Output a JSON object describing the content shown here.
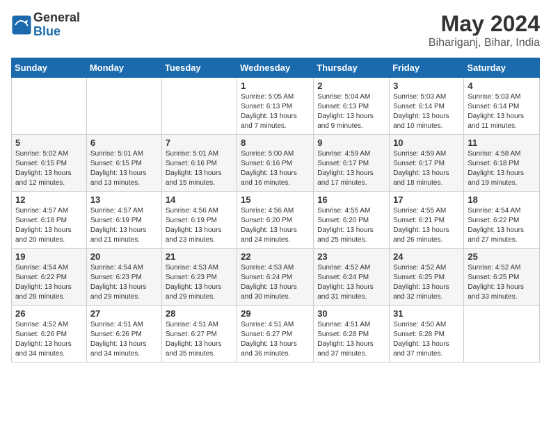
{
  "logo": {
    "general": "General",
    "blue": "Blue"
  },
  "title": {
    "month_year": "May 2024",
    "location": "Bihariganj, Bihar, India"
  },
  "weekdays": [
    "Sunday",
    "Monday",
    "Tuesday",
    "Wednesday",
    "Thursday",
    "Friday",
    "Saturday"
  ],
  "weeks": [
    [
      {
        "day": "",
        "sunrise": "",
        "sunset": "",
        "daylight": ""
      },
      {
        "day": "",
        "sunrise": "",
        "sunset": "",
        "daylight": ""
      },
      {
        "day": "",
        "sunrise": "",
        "sunset": "",
        "daylight": ""
      },
      {
        "day": "1",
        "sunrise": "Sunrise: 5:05 AM",
        "sunset": "Sunset: 6:13 PM",
        "daylight": "Daylight: 13 hours and 7 minutes."
      },
      {
        "day": "2",
        "sunrise": "Sunrise: 5:04 AM",
        "sunset": "Sunset: 6:13 PM",
        "daylight": "Daylight: 13 hours and 9 minutes."
      },
      {
        "day": "3",
        "sunrise": "Sunrise: 5:03 AM",
        "sunset": "Sunset: 6:14 PM",
        "daylight": "Daylight: 13 hours and 10 minutes."
      },
      {
        "day": "4",
        "sunrise": "Sunrise: 5:03 AM",
        "sunset": "Sunset: 6:14 PM",
        "daylight": "Daylight: 13 hours and 11 minutes."
      }
    ],
    [
      {
        "day": "5",
        "sunrise": "Sunrise: 5:02 AM",
        "sunset": "Sunset: 6:15 PM",
        "daylight": "Daylight: 13 hours and 12 minutes."
      },
      {
        "day": "6",
        "sunrise": "Sunrise: 5:01 AM",
        "sunset": "Sunset: 6:15 PM",
        "daylight": "Daylight: 13 hours and 13 minutes."
      },
      {
        "day": "7",
        "sunrise": "Sunrise: 5:01 AM",
        "sunset": "Sunset: 6:16 PM",
        "daylight": "Daylight: 13 hours and 15 minutes."
      },
      {
        "day": "8",
        "sunrise": "Sunrise: 5:00 AM",
        "sunset": "Sunset: 6:16 PM",
        "daylight": "Daylight: 13 hours and 16 minutes."
      },
      {
        "day": "9",
        "sunrise": "Sunrise: 4:59 AM",
        "sunset": "Sunset: 6:17 PM",
        "daylight": "Daylight: 13 hours and 17 minutes."
      },
      {
        "day": "10",
        "sunrise": "Sunrise: 4:59 AM",
        "sunset": "Sunset: 6:17 PM",
        "daylight": "Daylight: 13 hours and 18 minutes."
      },
      {
        "day": "11",
        "sunrise": "Sunrise: 4:58 AM",
        "sunset": "Sunset: 6:18 PM",
        "daylight": "Daylight: 13 hours and 19 minutes."
      }
    ],
    [
      {
        "day": "12",
        "sunrise": "Sunrise: 4:57 AM",
        "sunset": "Sunset: 6:18 PM",
        "daylight": "Daylight: 13 hours and 20 minutes."
      },
      {
        "day": "13",
        "sunrise": "Sunrise: 4:57 AM",
        "sunset": "Sunset: 6:19 PM",
        "daylight": "Daylight: 13 hours and 21 minutes."
      },
      {
        "day": "14",
        "sunrise": "Sunrise: 4:56 AM",
        "sunset": "Sunset: 6:19 PM",
        "daylight": "Daylight: 13 hours and 23 minutes."
      },
      {
        "day": "15",
        "sunrise": "Sunrise: 4:56 AM",
        "sunset": "Sunset: 6:20 PM",
        "daylight": "Daylight: 13 hours and 24 minutes."
      },
      {
        "day": "16",
        "sunrise": "Sunrise: 4:55 AM",
        "sunset": "Sunset: 6:20 PM",
        "daylight": "Daylight: 13 hours and 25 minutes."
      },
      {
        "day": "17",
        "sunrise": "Sunrise: 4:55 AM",
        "sunset": "Sunset: 6:21 PM",
        "daylight": "Daylight: 13 hours and 26 minutes."
      },
      {
        "day": "18",
        "sunrise": "Sunrise: 4:54 AM",
        "sunset": "Sunset: 6:22 PM",
        "daylight": "Daylight: 13 hours and 27 minutes."
      }
    ],
    [
      {
        "day": "19",
        "sunrise": "Sunrise: 4:54 AM",
        "sunset": "Sunset: 6:22 PM",
        "daylight": "Daylight: 13 hours and 28 minutes."
      },
      {
        "day": "20",
        "sunrise": "Sunrise: 4:54 AM",
        "sunset": "Sunset: 6:23 PM",
        "daylight": "Daylight: 13 hours and 29 minutes."
      },
      {
        "day": "21",
        "sunrise": "Sunrise: 4:53 AM",
        "sunset": "Sunset: 6:23 PM",
        "daylight": "Daylight: 13 hours and 29 minutes."
      },
      {
        "day": "22",
        "sunrise": "Sunrise: 4:53 AM",
        "sunset": "Sunset: 6:24 PM",
        "daylight": "Daylight: 13 hours and 30 minutes."
      },
      {
        "day": "23",
        "sunrise": "Sunrise: 4:52 AM",
        "sunset": "Sunset: 6:24 PM",
        "daylight": "Daylight: 13 hours and 31 minutes."
      },
      {
        "day": "24",
        "sunrise": "Sunrise: 4:52 AM",
        "sunset": "Sunset: 6:25 PM",
        "daylight": "Daylight: 13 hours and 32 minutes."
      },
      {
        "day": "25",
        "sunrise": "Sunrise: 4:52 AM",
        "sunset": "Sunset: 6:25 PM",
        "daylight": "Daylight: 13 hours and 33 minutes."
      }
    ],
    [
      {
        "day": "26",
        "sunrise": "Sunrise: 4:52 AM",
        "sunset": "Sunset: 6:26 PM",
        "daylight": "Daylight: 13 hours and 34 minutes."
      },
      {
        "day": "27",
        "sunrise": "Sunrise: 4:51 AM",
        "sunset": "Sunset: 6:26 PM",
        "daylight": "Daylight: 13 hours and 34 minutes."
      },
      {
        "day": "28",
        "sunrise": "Sunrise: 4:51 AM",
        "sunset": "Sunset: 6:27 PM",
        "daylight": "Daylight: 13 hours and 35 minutes."
      },
      {
        "day": "29",
        "sunrise": "Sunrise: 4:51 AM",
        "sunset": "Sunset: 6:27 PM",
        "daylight": "Daylight: 13 hours and 36 minutes."
      },
      {
        "day": "30",
        "sunrise": "Sunrise: 4:51 AM",
        "sunset": "Sunset: 6:28 PM",
        "daylight": "Daylight: 13 hours and 37 minutes."
      },
      {
        "day": "31",
        "sunrise": "Sunrise: 4:50 AM",
        "sunset": "Sunset: 6:28 PM",
        "daylight": "Daylight: 13 hours and 37 minutes."
      },
      {
        "day": "",
        "sunrise": "",
        "sunset": "",
        "daylight": ""
      }
    ]
  ]
}
